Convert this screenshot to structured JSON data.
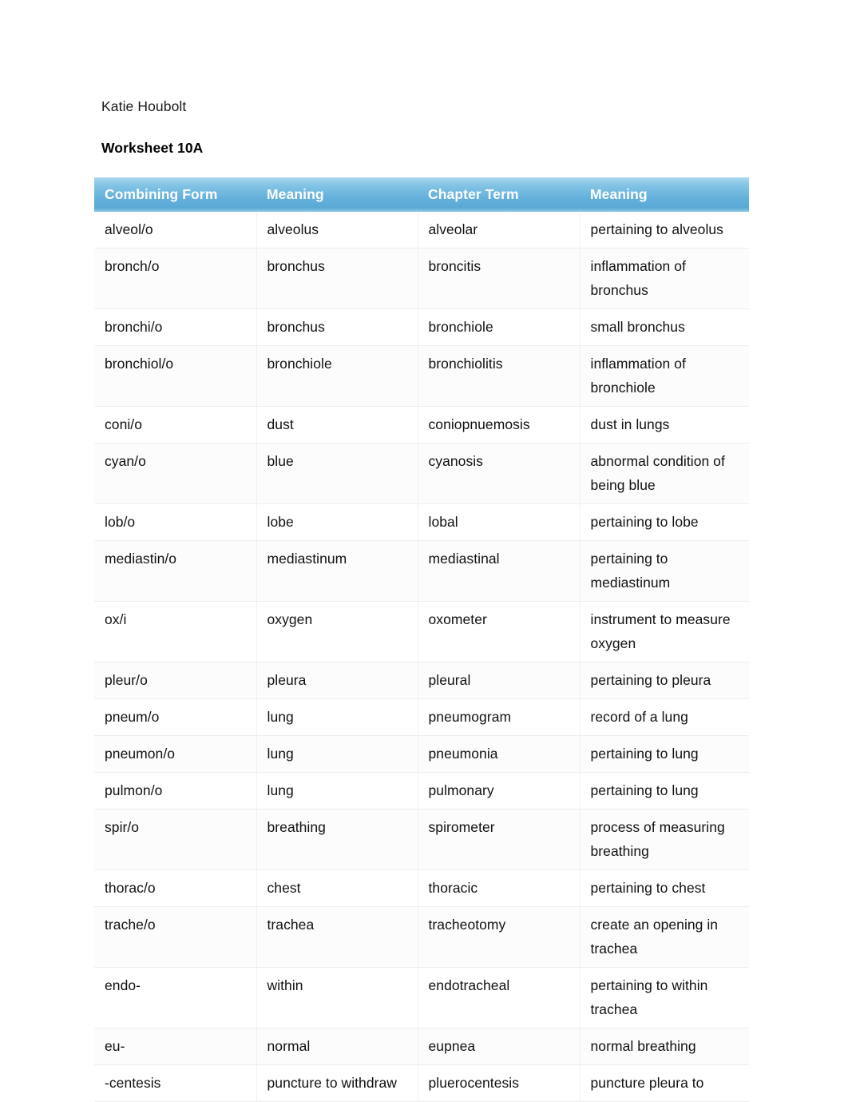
{
  "document": {
    "author": "Katie Houbolt",
    "title": "Worksheet 10A"
  },
  "theme": {
    "header_blue_light": "#a9d7ee",
    "header_blue_mid": "#84c4e5",
    "header_blue_dark": "#5aa9d6",
    "header_text_color": "#ffffff",
    "body_text_color": "#111111",
    "row_border_color": "#ededed",
    "page_background": "#ffffff"
  },
  "table": {
    "columns": [
      "Combining Form",
      "Meaning",
      "Chapter Term",
      "Meaning"
    ],
    "rows": [
      [
        "alveol/o",
        "alveolus",
        "alveolar",
        "pertaining to alveolus"
      ],
      [
        "bronch/o",
        "bronchus",
        "broncitis",
        "inflammation of bronchus"
      ],
      [
        "bronchi/o",
        "bronchus",
        "bronchiole",
        "small bronchus"
      ],
      [
        "bronchiol/o",
        "bronchiole",
        "bronchiolitis",
        "inflammation of bronchiole"
      ],
      [
        "coni/o",
        "dust",
        "coniopnuemosis",
        "dust in lungs"
      ],
      [
        "cyan/o",
        "blue",
        "cyanosis",
        "abnormal condition of being blue"
      ],
      [
        "lob/o",
        "lobe",
        "lobal",
        "pertaining to lobe"
      ],
      [
        "mediastin/o",
        "mediastinum",
        "mediastinal",
        "pertaining to mediastinum"
      ],
      [
        "ox/i",
        "oxygen",
        "oxometer",
        "instrument to measure oxygen"
      ],
      [
        "pleur/o",
        "pleura",
        "pleural",
        "pertaining to pleura"
      ],
      [
        "pneum/o",
        "lung",
        "pneumogram",
        "record of a lung"
      ],
      [
        "pneumon/o",
        "lung",
        "pneumonia",
        "pertaining to lung"
      ],
      [
        "pulmon/o",
        "lung",
        "pulmonary",
        "pertaining to lung"
      ],
      [
        "spir/o",
        "breathing",
        "spirometer",
        "process of measuring breathing"
      ],
      [
        "thorac/o",
        "chest",
        "thoracic",
        "pertaining to chest"
      ],
      [
        "trache/o",
        "trachea",
        "tracheotomy",
        "create an opening in trachea"
      ],
      [
        "endo-",
        "within",
        "endotracheal",
        "pertaining to within trachea"
      ],
      [
        "eu-",
        "normal",
        "eupnea",
        "normal breathing"
      ],
      [
        "-centesis",
        "puncture to withdraw",
        "pluerocentesis",
        "puncture pleura to"
      ]
    ]
  }
}
